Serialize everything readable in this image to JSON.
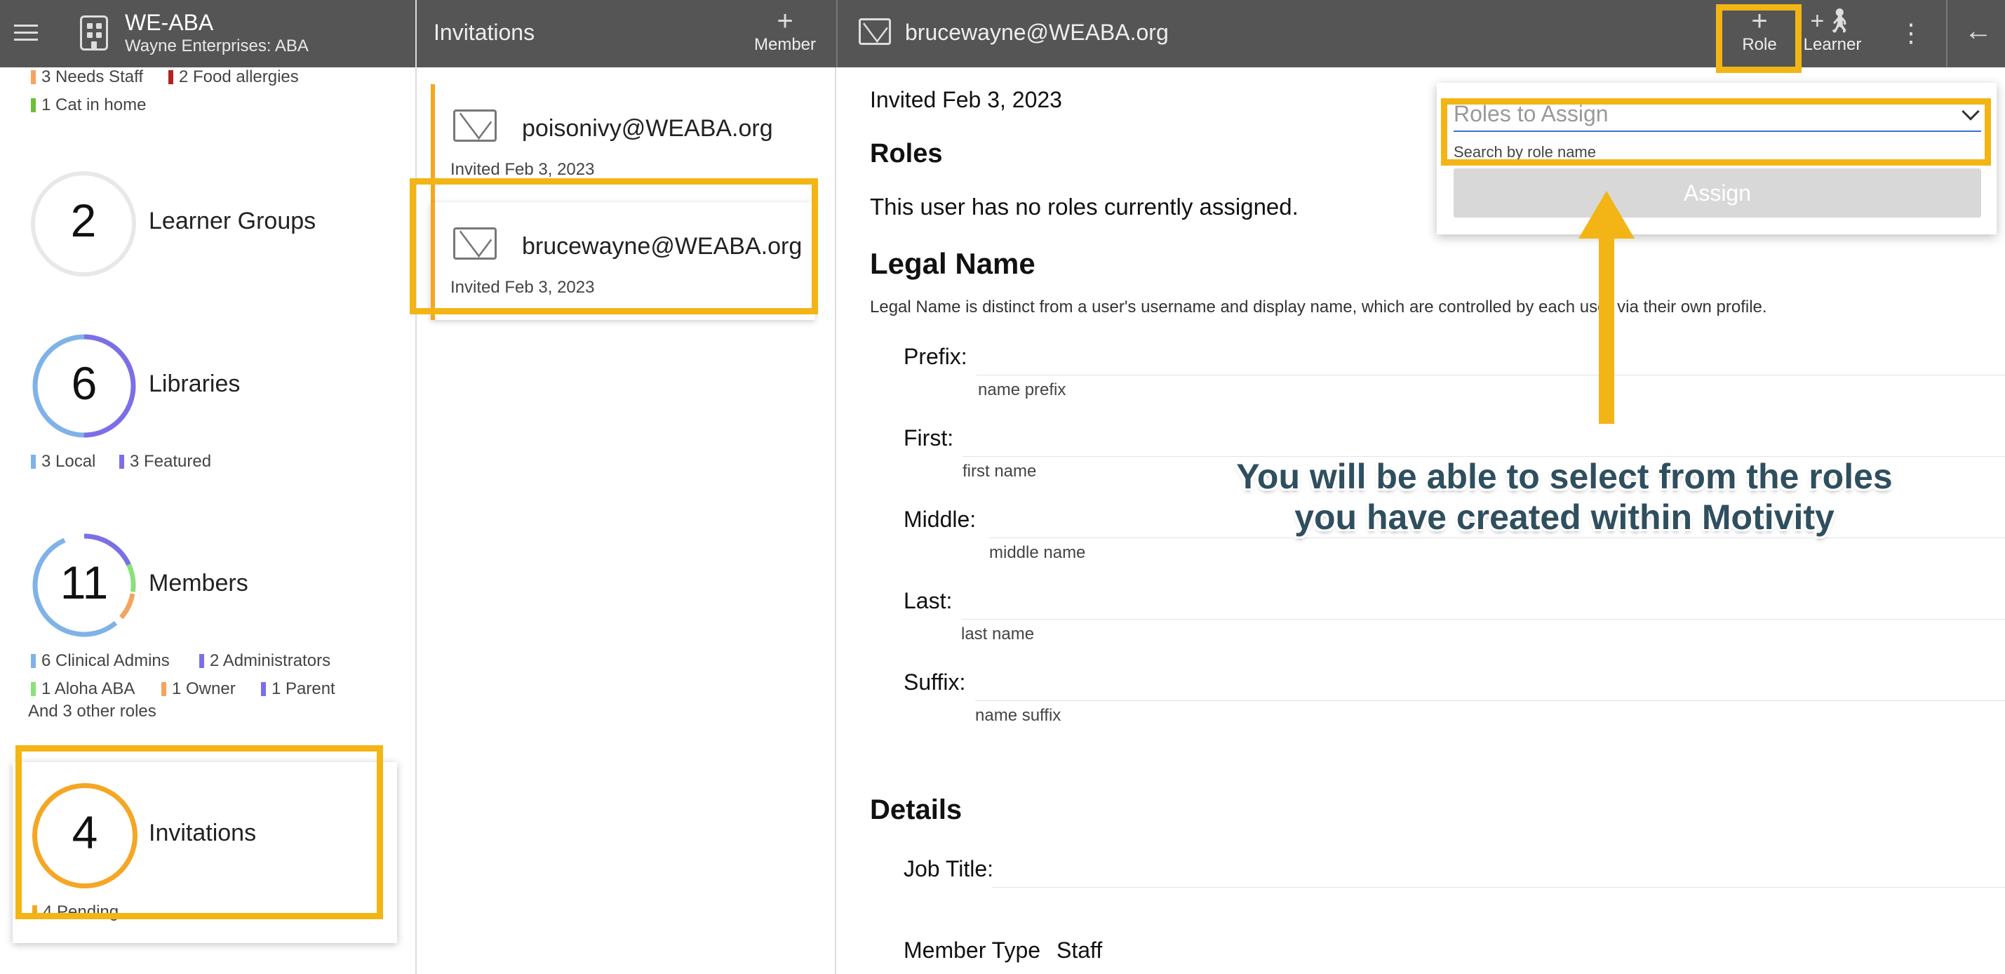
{
  "header": {
    "org_name": "WE-ABA",
    "org_subtitle": "Wayne Enterprises: ABA",
    "invitations_title": "Invitations",
    "member_button": "Member",
    "detail_email": "brucewayne@WEABA.org",
    "role_button": "Role",
    "learner_button": "Learner"
  },
  "sidebar": {
    "top_tags": [
      {
        "text": "3 Needs Staff",
        "color": "#f4a460"
      },
      {
        "text": "2 Food allergies",
        "color": "#b22222"
      },
      {
        "text": "1 Cat in home",
        "color": "#6cbf3a"
      }
    ],
    "learner_groups": {
      "count": "2",
      "label": "Learner Groups"
    },
    "libraries": {
      "count": "6",
      "label": "Libraries",
      "tags": [
        {
          "text": "3 Local",
          "color": "#7fb2e8"
        },
        {
          "text": "3 Featured",
          "color": "#7b6fe8"
        }
      ]
    },
    "members": {
      "count": "11",
      "label": "Members",
      "tags": [
        {
          "text": "6 Clinical Admins",
          "color": "#7fb2e8"
        },
        {
          "text": "2 Administrators",
          "color": "#7b6fe8"
        },
        {
          "text": "1 Aloha ABA",
          "color": "#8be07a"
        },
        {
          "text": "1 Owner",
          "color": "#f4a460"
        },
        {
          "text": "1 Parent",
          "color": "#7b6fe8"
        }
      ],
      "more": "And 3 other roles"
    },
    "invitations": {
      "count": "4",
      "label": "Invitations",
      "tag": "4 Pending",
      "color": "#f5a623"
    }
  },
  "invitations_list": [
    {
      "email": "poisonivy@WEABA.org",
      "date": "Invited Feb 3, 2023"
    },
    {
      "email": "brucewayne@WEABA.org",
      "date": "Invited Feb 3, 2023"
    }
  ],
  "detail": {
    "invited": "Invited Feb 3, 2023",
    "roles_heading": "Roles",
    "roles_text": "This user has no roles currently assigned.",
    "legal_heading": "Legal Name",
    "legal_desc": "Legal Name is distinct from a user's username and display name, which are controlled by each user via their own profile.",
    "fields": [
      {
        "label": "Prefix:",
        "placeholder": "name prefix"
      },
      {
        "label": "First:",
        "placeholder": "first name"
      },
      {
        "label": "Middle:",
        "placeholder": "middle name"
      },
      {
        "label": "Last:",
        "placeholder": "last name"
      },
      {
        "label": "Suffix:",
        "placeholder": "name suffix"
      }
    ],
    "details_heading": "Details",
    "job_title_label": "Job Title:",
    "member_type_label": "Member Type",
    "member_type_value": "Staff"
  },
  "role_popup": {
    "placeholder": "Roles to Assign",
    "hint": "Search by role name",
    "assign_button": "Assign"
  },
  "annotation": {
    "line1": "You will be able to select from the roles",
    "line2": "you have created within Motivity"
  },
  "colors": {
    "highlight": "#f3b515",
    "topbar": "#555555"
  }
}
